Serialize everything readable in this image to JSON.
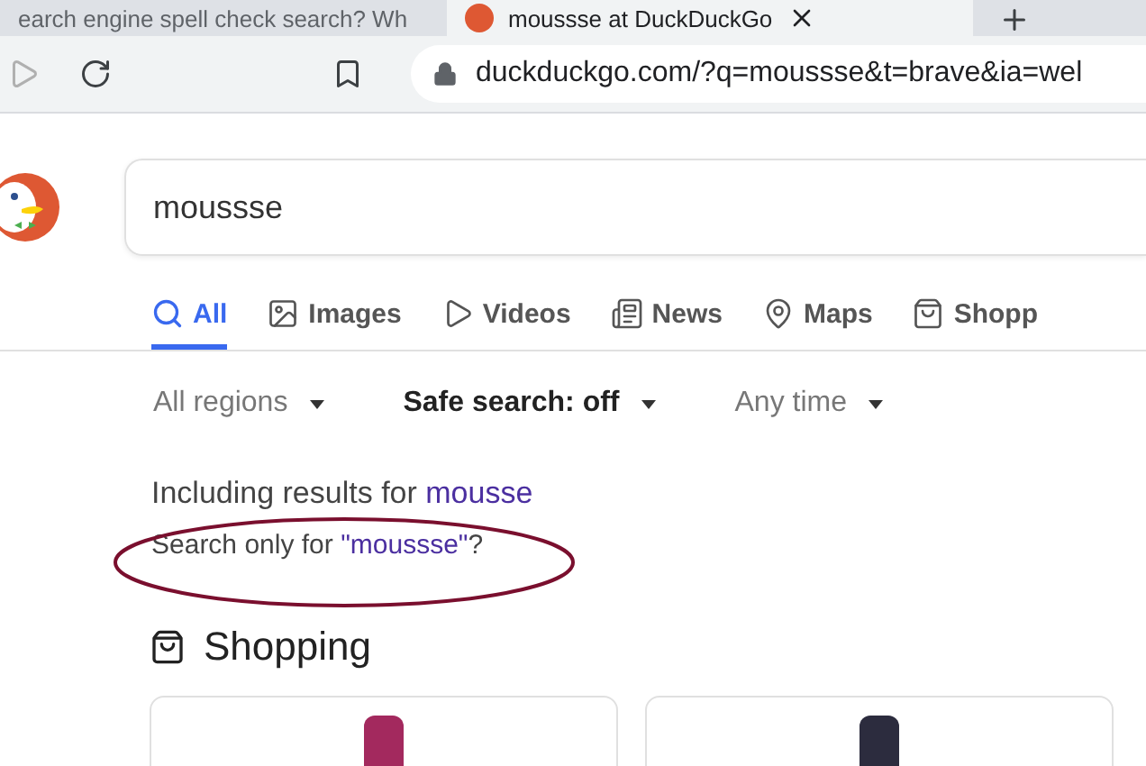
{
  "browser_tabs": [
    {
      "title": "earch engine spell check search? Wh",
      "selected": false
    },
    {
      "title": "moussse at DuckDuckGo",
      "selected": true
    }
  ],
  "address_bar": {
    "url": "duckduckgo.com/?q=moussse&t=brave&ia=wel"
  },
  "search": {
    "value": "moussse"
  },
  "nav_tabs": [
    {
      "label": "All",
      "kind": "search",
      "selected": true
    },
    {
      "label": "Images",
      "kind": "image",
      "selected": false
    },
    {
      "label": "Videos",
      "kind": "play",
      "selected": false
    },
    {
      "label": "News",
      "kind": "news",
      "selected": false
    },
    {
      "label": "Maps",
      "kind": "pin",
      "selected": false
    },
    {
      "label": "Shopp",
      "kind": "bag",
      "selected": false
    }
  ],
  "filters": [
    {
      "label": "All regions",
      "changed": false
    },
    {
      "label": "Safe search: off",
      "changed": true
    },
    {
      "label": "Any time",
      "changed": false
    }
  ],
  "spelling": {
    "including": "Including results for ",
    "corrected": "mousse",
    "search_only": "Search only for ",
    "original": "\"moussse\"",
    "suffix": "?",
    "circled": true
  },
  "shopping": {
    "heading": "Shopping",
    "products": [
      {
        "color": "#a3295e"
      },
      {
        "color": "#2c2c3e"
      }
    ]
  }
}
